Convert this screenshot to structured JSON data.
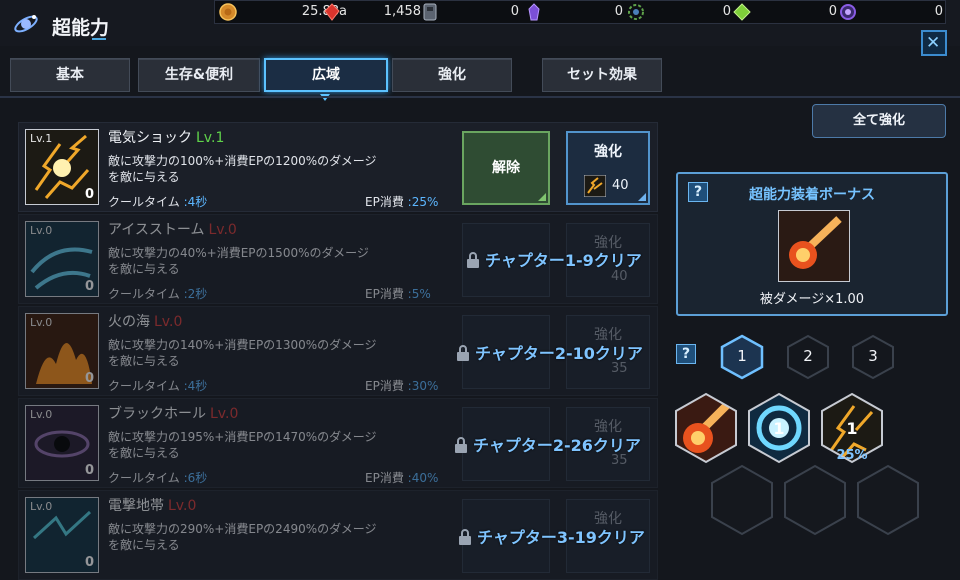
{
  "header": {
    "title": "超能力",
    "title_icon": "galaxy-icon"
  },
  "resources": [
    {
      "icon": "gold-coin-icon",
      "value": "25.88a",
      "color": "#d58a2a"
    },
    {
      "icon": "ruby-icon",
      "value": "1,458",
      "color": "#d9342d"
    },
    {
      "icon": "ticket-icon",
      "value": "0",
      "color": "#7c8694"
    },
    {
      "icon": "purple-crystal-icon",
      "value": "0",
      "color": "#7b4fd6"
    },
    {
      "icon": "gear-orb-icon",
      "value": "0",
      "color": "#5fa24a"
    },
    {
      "icon": "green-gem-icon",
      "value": "0",
      "color": "#7fcf3a"
    },
    {
      "icon": "purple-orb-icon",
      "value": "0",
      "color": "#8a5ce6"
    }
  ],
  "tabs": [
    {
      "label": "基本"
    },
    {
      "label": "生存&便利"
    },
    {
      "label": "広域",
      "active": true
    },
    {
      "label": "強化"
    },
    {
      "label": "セット効果"
    }
  ],
  "skills": [
    {
      "name": "電気ショック",
      "level": "Lv.1",
      "level_color": "#5fd24a",
      "icon_level": "Lv.1",
      "count": "0",
      "desc": "敵に攻撃力の100%+消費EPの1200%のダメージを敵に与える",
      "cooldown_label": "クールタイム",
      "cooldown": ":4秒",
      "ep_label": "EP消費",
      "ep": ":25%",
      "release_label": "解除",
      "upgrade_label": "強化",
      "upgrade_cost": "40",
      "icon": "electric-shock-icon"
    },
    {
      "name": "アイスストーム",
      "level": "Lv.0",
      "level_color": "#d03a3a",
      "icon_level": "Lv.0",
      "count": "0",
      "desc": "敵に攻撃力の40%+消費EPの1500%のダメージを敵に与える",
      "cooldown_label": "クールタイム",
      "cooldown": ":2秒",
      "ep_label": "EP消費",
      "ep": ":5%",
      "unlock": "チャプター1-9クリア",
      "upgrade_label": "強化",
      "upgrade_cost": "40",
      "icon": "ice-storm-icon"
    },
    {
      "name": "火の海",
      "level": "Lv.0",
      "level_color": "#d03a3a",
      "icon_level": "Lv.0",
      "count": "0",
      "desc": "敵に攻撃力の140%+消費EPの1300%のダメージを敵に与える",
      "cooldown_label": "クールタイム",
      "cooldown": ":4秒",
      "ep_label": "EP消費",
      "ep": ":30%",
      "unlock": "チャプター2-10クリア",
      "upgrade_label": "強化",
      "upgrade_cost": "35",
      "icon": "sea-of-fire-icon"
    },
    {
      "name": "ブラックホール",
      "level": "Lv.0",
      "level_color": "#d03a3a",
      "icon_level": "Lv.0",
      "count": "0",
      "desc": "敵に攻撃力の195%+消費EPの1470%のダメージを敵に与える",
      "cooldown_label": "クールタイム",
      "cooldown": ":6秒",
      "ep_label": "EP消費",
      "ep": ":40%",
      "unlock": "チャプター2-26クリア",
      "upgrade_label": "強化",
      "upgrade_cost": "35",
      "icon": "black-hole-icon"
    },
    {
      "name": "電撃地帯",
      "level": "Lv.0",
      "level_color": "#d03a3a",
      "icon_level": "Lv.0",
      "count": "0",
      "desc": "敵に攻撃力の290%+消費EPの2490%のダメージを敵に与える",
      "cooldown_label": "クールタイム",
      "cooldown": "",
      "ep_label": "EP消費",
      "ep": "",
      "unlock": "チャプター3-19クリア",
      "upgrade_label": "強化",
      "upgrade_cost": "",
      "icon": "electric-zone-icon"
    }
  ],
  "right_panel": {
    "strengthen_all": "全て強化",
    "bonus_title": "超能力装着ボーナス",
    "bonus_text": "被ダメージ×1.00",
    "bonus_icon": "meteor-icon",
    "help": "?",
    "presets": [
      "1",
      "2",
      "3"
    ],
    "equipped": [
      {
        "icon": "meteor-icon",
        "label": ""
      },
      {
        "icon": "lightning-orb-icon",
        "label": "1"
      },
      {
        "icon": "electric-shock-icon",
        "label": "1",
        "pct": "25%"
      }
    ]
  }
}
